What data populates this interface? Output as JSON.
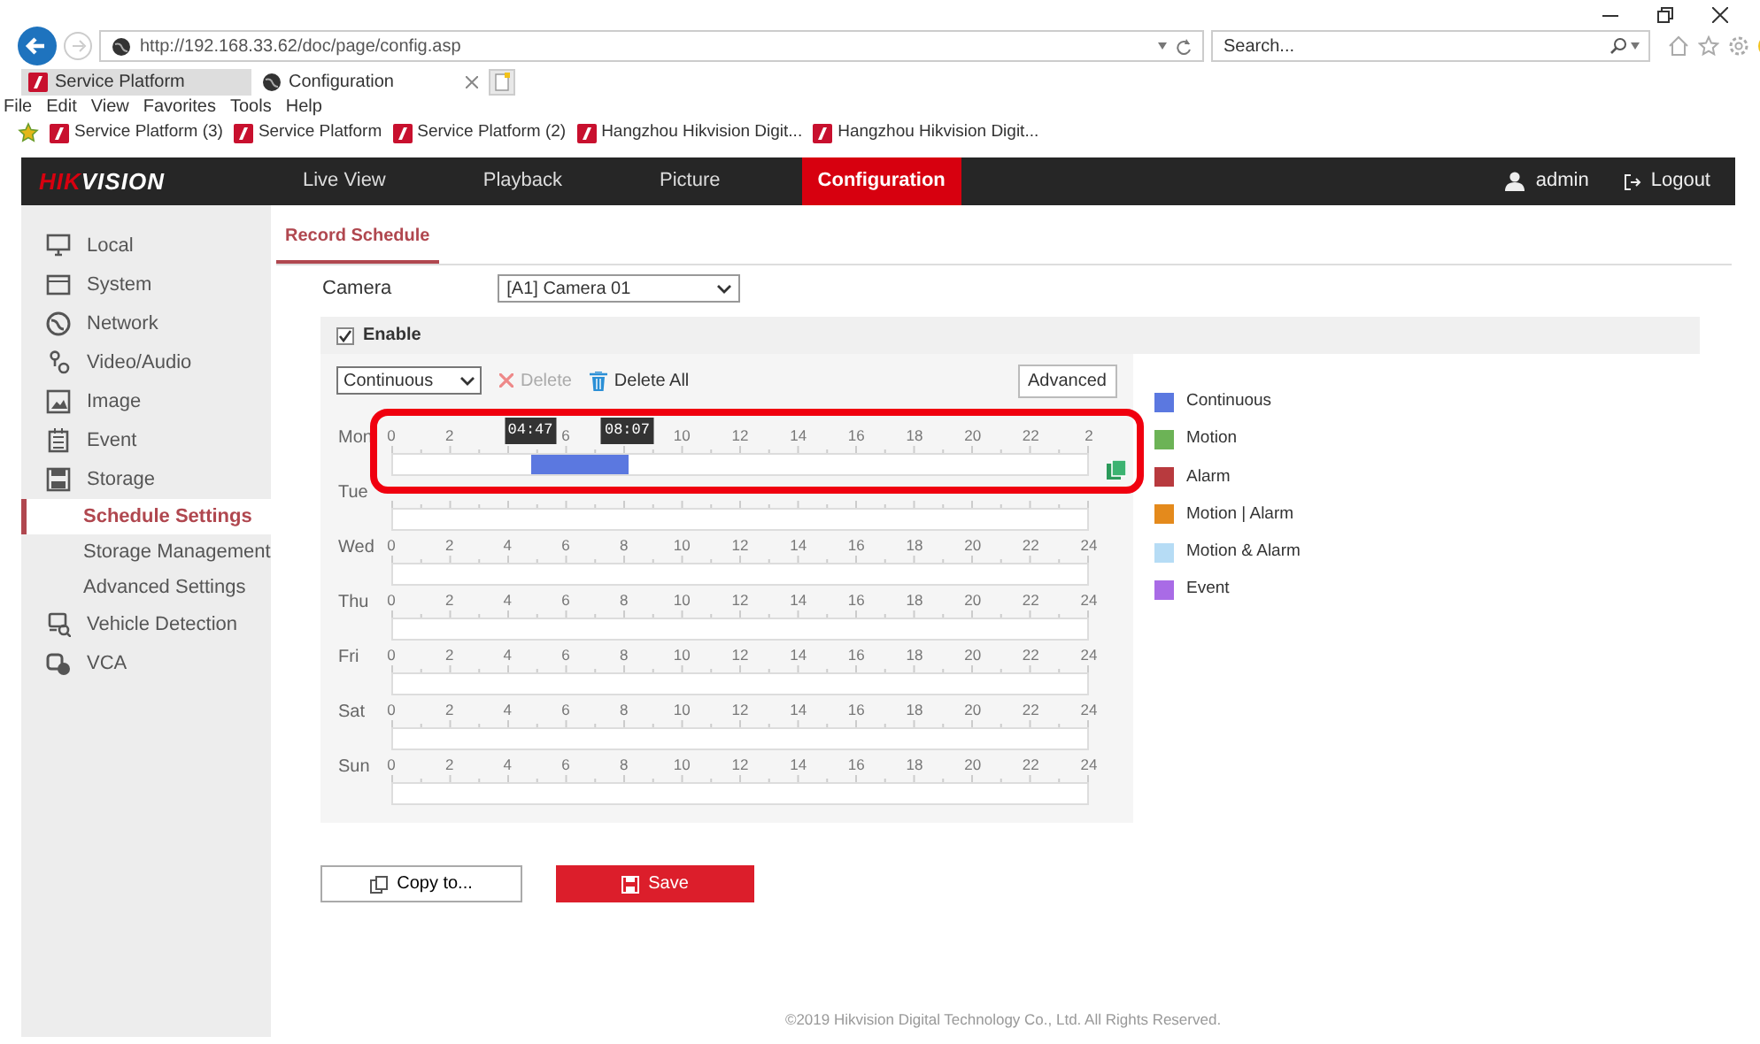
{
  "browser": {
    "address": "http://192.168.33.62/doc/page/config.asp",
    "search": {
      "placeholder": "Search..."
    },
    "tabs": [
      {
        "label": "Service Platform",
        "selected": false
      },
      {
        "label": "Configuration",
        "selected": true
      }
    ],
    "menu": [
      "File",
      "Edit",
      "View",
      "Favorites",
      "Tools",
      "Help"
    ],
    "favorites": [
      "Service Platform (3)",
      "Service Platform",
      "Service Platform (2)",
      "Hangzhou Hikvision Digit...",
      "Hangzhou Hikvision Digit..."
    ]
  },
  "app": {
    "logo": [
      "HIK",
      "VISION"
    ],
    "nav": [
      {
        "label": "Live View",
        "selected": false
      },
      {
        "label": "Playback",
        "selected": false
      },
      {
        "label": "Picture",
        "selected": false
      },
      {
        "label": "Configuration",
        "selected": true
      }
    ],
    "user": "admin",
    "logout": "Logout"
  },
  "sidebar": {
    "items": [
      {
        "label": "Local",
        "selected": false
      },
      {
        "label": "System",
        "selected": false
      },
      {
        "label": "Network",
        "selected": false
      },
      {
        "label": "Video/Audio",
        "selected": false
      },
      {
        "label": "Image",
        "selected": false
      },
      {
        "label": "Event",
        "selected": false
      },
      {
        "label": "Storage",
        "selected": false,
        "children": [
          {
            "label": "Schedule Settings",
            "selected": true
          },
          {
            "label": "Storage Management",
            "selected": false
          },
          {
            "label": "Advanced Settings",
            "selected": false
          }
        ]
      },
      {
        "label": "Vehicle Detection",
        "selected": false
      },
      {
        "label": "VCA",
        "selected": false
      }
    ]
  },
  "page": {
    "tabs": [
      {
        "label": "Record Schedule",
        "selected": true
      }
    ],
    "camera_label": "Camera",
    "camera": "[A1] Camera 01",
    "enable": {
      "label": "Enable",
      "checked": true
    },
    "record_type": "Continuous",
    "delete": {
      "label": "Delete",
      "disabled": true
    },
    "delete_all": {
      "label": "Delete All",
      "disabled": false
    },
    "advanced": "Advanced",
    "days": [
      {
        "day": "Mon",
        "highlighted": true,
        "copy_icon": true,
        "ticks": [
          "0",
          "2",
          "6",
          "10",
          "12",
          "14",
          "16",
          "18",
          "20",
          "22",
          "2"
        ],
        "segments": [
          {
            "start": "04:47",
            "end": "08:07",
            "color": "#5b78e0"
          }
        ]
      },
      {
        "day": "Tue",
        "highlighted": false,
        "copy_icon": false
      },
      {
        "day": "Wed",
        "highlighted": false,
        "copy_icon": false,
        "ticks": [
          "0",
          "2",
          "4",
          "6",
          "8",
          "10",
          "12",
          "14",
          "16",
          "18",
          "20",
          "22",
          "24"
        ]
      },
      {
        "day": "Thu",
        "highlighted": false,
        "copy_icon": false,
        "ticks": [
          "0",
          "2",
          "4",
          "6",
          "8",
          "10",
          "12",
          "14",
          "16",
          "18",
          "20",
          "22",
          "24"
        ]
      },
      {
        "day": "Fri",
        "highlighted": false,
        "copy_icon": false,
        "ticks": [
          "0",
          "2",
          "4",
          "6",
          "8",
          "10",
          "12",
          "14",
          "16",
          "18",
          "20",
          "22",
          "24"
        ]
      },
      {
        "day": "Sat",
        "highlighted": false,
        "copy_icon": false,
        "ticks": [
          "0",
          "2",
          "4",
          "6",
          "8",
          "10",
          "12",
          "14",
          "16",
          "18",
          "20",
          "22",
          "24"
        ]
      },
      {
        "day": "Sun",
        "highlighted": false,
        "copy_icon": false,
        "ticks": [
          "0",
          "2",
          "4",
          "6",
          "8",
          "10",
          "12",
          "14",
          "16",
          "18",
          "20",
          "22",
          "24"
        ]
      }
    ],
    "legend": [
      {
        "label": "Continuous",
        "color": "#5b78e0"
      },
      {
        "label": "Motion",
        "color": "#6cb356"
      },
      {
        "label": "Alarm",
        "color": "#b83a3e"
      },
      {
        "label": "Motion | Alarm",
        "color": "#e48a1c"
      },
      {
        "label": "Motion & Alarm",
        "color": "#b6dcf5"
      },
      {
        "label": "Event",
        "color": "#a96be6"
      }
    ],
    "copy_to": "Copy to...",
    "save": "Save"
  },
  "footer": "©2019 Hikvision Digital Technology Co., Ltd. All Rights Reserved."
}
